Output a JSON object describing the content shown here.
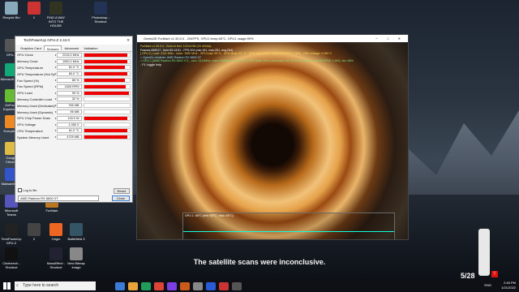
{
  "desktop": {
    "icons_left": [
      {
        "label": "Recycle Bin",
        "color": "#8ab"
      },
      {
        "label": "GPU-Z",
        "color": "#555"
      },
      {
        "label": "Microsoft Edge",
        "color": "#1a7"
      },
      {
        "label": "GeForce Experience",
        "color": "#6b3"
      },
      {
        "label": "Everything",
        "color": "#e82"
      },
      {
        "label": "Google Chrome",
        "color": "#db4"
      },
      {
        "label": "Malwarebytes",
        "color": "#35c"
      },
      {
        "label": "Microsoft Teams",
        "color": "#55b"
      },
      {
        "label": "TechPowerUp GPU-Z",
        "color": "#222"
      },
      {
        "label": "Cinebench - Shortcut",
        "color": "#111"
      }
    ],
    "icons_top": [
      {
        "label": "1",
        "color": "#c33"
      },
      {
        "label": "FIND A WAY INTO THE HOUSE",
        "color": "#332"
      },
      {
        "label": "Photoshop - Shortcut",
        "color": "#235"
      }
    ],
    "icons_bottom": [
      {
        "label": "FurMark",
        "color": "#b72"
      },
      {
        "label": "2",
        "color": "#444"
      },
      {
        "label": "Origin",
        "color": "#e62"
      },
      {
        "label": "Battlefield 3",
        "color": "#356"
      },
      {
        "label": "MassEffect - Shortcut",
        "color": "#223"
      },
      {
        "label": "New Bitmap Image",
        "color": "#888"
      }
    ]
  },
  "gpuz": {
    "title": "TechPowerUp GPU-Z 2.44.0",
    "tabs": [
      "Graphics Card",
      "Sensors",
      "Advanced",
      "Validation"
    ],
    "sensors": [
      {
        "label": "GPU Clock",
        "value": "2215.0 MHz",
        "level": 0.95
      },
      {
        "label": "Memory Clock",
        "value": "1990.0 MHz",
        "level": 0.95
      },
      {
        "label": "GPU Temperature",
        "value": "61.0 °C",
        "level": 0.9
      },
      {
        "label": "GPU Temperature (Hot Spot)",
        "value": "80.0 °C",
        "level": 0.95
      },
      {
        "label": "Fan Speed (%)",
        "value": "85 %",
        "level": 0.9
      },
      {
        "label": "Fan Speed (RPM)",
        "value": "2428 RPM",
        "level": 0.92
      },
      {
        "label": "GPU Load",
        "value": "99 %",
        "level": 0.98
      },
      {
        "label": "Memory Controller Load",
        "value": "32 %",
        "level": 0.0
      },
      {
        "label": "Memory Used (Dedicated)",
        "value": "765 MB",
        "level": 0.0
      },
      {
        "label": "Memory Used (Dynamic)",
        "value": "96 MB",
        "level": 0.0
      },
      {
        "label": "GPU Chip Power Draw",
        "value": "149.0 W",
        "level": 0.95
      },
      {
        "label": "GPU Voltage",
        "value": "1.050 V",
        "level": 0.0
      },
      {
        "label": "CPU Temperature",
        "value": "61.0 °C",
        "level": 0.95
      },
      {
        "label": "System Memory Used",
        "value": "4729 MB",
        "level": 0.95
      }
    ],
    "log_label": "Log to file",
    "reset_label": "Reset",
    "device": "AMD Radeon RX 6600 XT",
    "close_label": "Close"
  },
  "furmark": {
    "title": "Geeks3D FurMark v1.30.0.0 - 204FPS, GPU1 temp:65°C, GPU1 usage:99%",
    "overlay": [
      {
        "text": "FurMark v1.30.0.0 - Burn-in test, 1024x768 (0X MSAA)",
        "color": "#ffd84a"
      },
      {
        "text": "Frames:289917 - time:00:14:51 - FPS:204 (min:151, max:251, avg:204)",
        "color": "#ffffff"
      },
      {
        "text": "[ GPU-Z ] core: 2111 MHz - mem: 1990 MHz - GPU load: 99 % - GPU temp: 61 °C - GPU chip power: 149.0 W (PPW: 1.369) - GPU voltage: 0.950 V",
        "color": "#ffd84a"
      },
      {
        "text": "> OpenGL renderer: AMD Radeon RX 6600 XT",
        "color": "#9fe0ff"
      },
      {
        "text": "> GPU 1 (AMD Radeon RX 6600 XT) - core: 2111MHz, mem: 995MHz, temp: 65°C, GPU load: 99%, mem load: 4%, GPU chip power: 149 W (PPW: 1.369), fan: 86%",
        "color": "#7fe07f"
      },
      {
        "text": "- F1: toggle help",
        "color": "#ffffff"
      }
    ],
    "temp_label": "GPU 1: 65°C (min: 62°C - max: 65°C)"
  },
  "game": {
    "subtitle": "The satellite scans were inconclusive.",
    "ammo": "5/28"
  },
  "taskbar": {
    "search_placeholder": "Type here to search",
    "time": "2:46 PM",
    "date": "1/21/2022",
    "lang": "ENG"
  }
}
